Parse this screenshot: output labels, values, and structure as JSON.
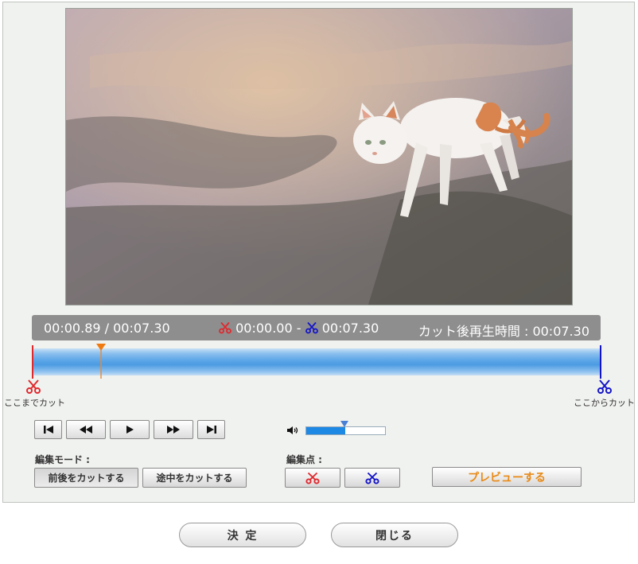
{
  "info": {
    "current_time": "00:00.89 / 00:07.30",
    "cut_start": "00:00.00",
    "range_sep": " - ",
    "cut_end": "00:07.30",
    "playback_time": "カット後再生時間 : 00:07.30"
  },
  "timeline": {
    "playhead_fraction": 0.122,
    "label_left": "ここまでカット",
    "label_right": "ここからカット"
  },
  "volume": {
    "level": 0.49
  },
  "edit_mode": {
    "label": "編集モード :",
    "btn_trim": "前後をカットする",
    "btn_middle": "途中をカットする"
  },
  "edit_point": {
    "label": "編集点 :"
  },
  "preview_label": "プレビューする",
  "footer": {
    "ok": "決 定",
    "close": "閉じる"
  },
  "colors": {
    "cut_start": "#e0282d",
    "cut_end": "#1414c8",
    "playhead": "#f07a10",
    "accent": "#e98a16"
  }
}
